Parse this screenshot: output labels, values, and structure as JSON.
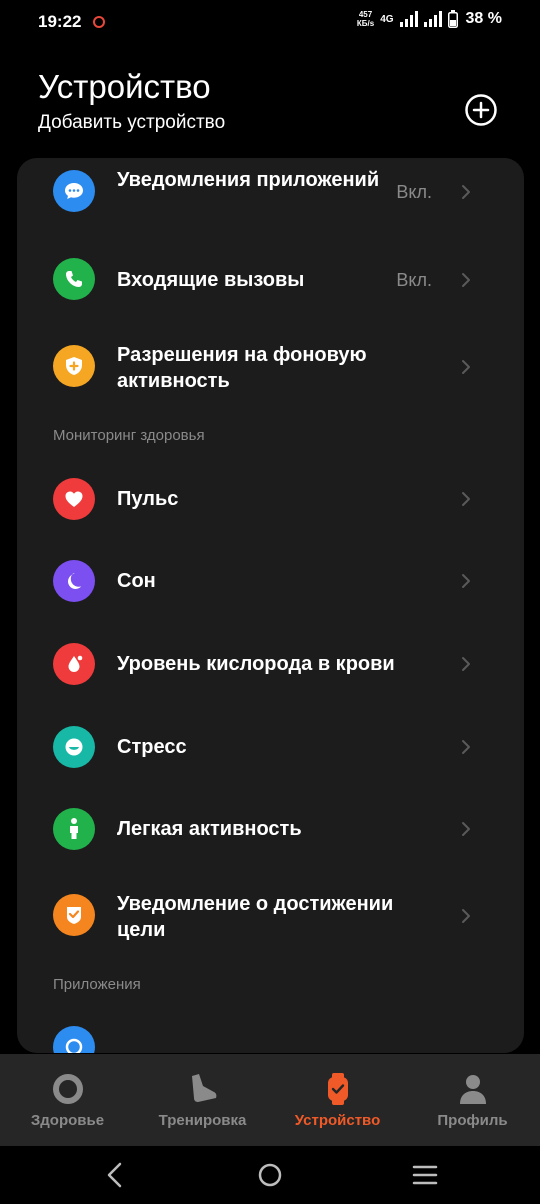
{
  "status_bar": {
    "time": "19:22",
    "net_speed_value": "457",
    "net_speed_unit": "КБ/s",
    "network_type": "4G",
    "battery": "38 %"
  },
  "header": {
    "title": "Устройство",
    "subtitle": "Добавить устройство"
  },
  "list": {
    "rows": [
      {
        "label": "Уведомления приложений",
        "value": "Вкл.",
        "icon": "chat-bubble-icon",
        "color": "#2d8cf0"
      },
      {
        "label": "Входящие вызовы",
        "value": "Вкл.",
        "icon": "phone-icon",
        "color": "#22b24c"
      },
      {
        "label": "Разрешения на фоновую активность",
        "value": "",
        "icon": "shield-plus-icon",
        "color": "#f5a623"
      },
      {
        "label": "Пульс",
        "value": "",
        "icon": "heart-icon",
        "color": "#ef3b3b"
      },
      {
        "label": "Сон",
        "value": "",
        "icon": "moon-icon",
        "color": "#7b4ff0"
      },
      {
        "label": "Уровень кислорода в крови",
        "value": "",
        "icon": "drop-icon",
        "color": "#ef3b3b"
      },
      {
        "label": "Стресс",
        "value": "",
        "icon": "face-icon",
        "color": "#17b8a6"
      },
      {
        "label": "Легкая активность",
        "value": "",
        "icon": "person-icon",
        "color": "#22b24c"
      },
      {
        "label": "Уведомление о достижении цели",
        "value": "",
        "icon": "badge-icon",
        "color": "#f5861f"
      }
    ],
    "sections": {
      "health": "Мониторинг здоровья",
      "apps": "Приложения"
    }
  },
  "bottom_nav": {
    "items": [
      {
        "label": "Здоровье",
        "icon": "ring-icon",
        "active": false
      },
      {
        "label": "Тренировка",
        "icon": "shoe-icon",
        "active": false
      },
      {
        "label": "Устройство",
        "icon": "watch-icon",
        "active": true
      },
      {
        "label": "Профиль",
        "icon": "user-icon",
        "active": false
      }
    ]
  },
  "colors": {
    "accent": "#f05a28",
    "card_bg": "#1c1c1c",
    "nav_bg": "#262626",
    "muted_text": "#8a8a8a"
  }
}
